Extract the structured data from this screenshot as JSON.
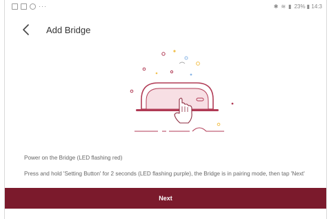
{
  "status_bar": {
    "left_icons": [
      "image-icon",
      "photo-icon",
      "sync-icon"
    ],
    "dots": "···",
    "right_text": "23% ▮ 14:3"
  },
  "header": {
    "title": "Add Bridge"
  },
  "instructions": {
    "line1": "Power on the Bridge (LED flashing red)",
    "line2": "Press and hold 'Setting Button' for 2 seconds (LED flashing purple), the Bridge is in pairing mode, then tap 'Next'"
  },
  "next_button": {
    "label": "Next"
  },
  "colors": {
    "accent": "#7b1a2c",
    "illustration_stroke": "#b03a54",
    "device_fill": "#f7dfe4"
  }
}
